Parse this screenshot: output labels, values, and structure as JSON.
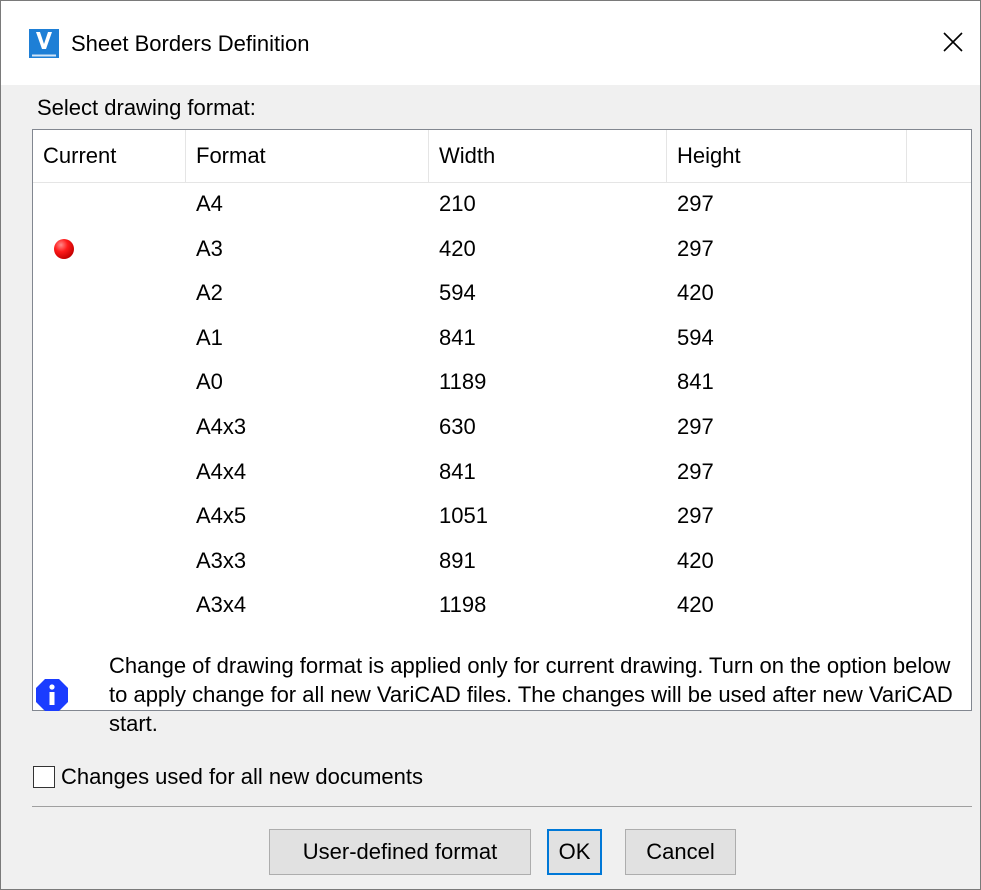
{
  "window": {
    "title": "Sheet Borders Definition",
    "icon": "varicad-logo-icon",
    "close_icon": "close-icon"
  },
  "select_label": "Select drawing format:",
  "table": {
    "columns": [
      "Current",
      "Format",
      "Width",
      "Height"
    ],
    "rows": [
      {
        "current": false,
        "format": "A4",
        "width": "210",
        "height": "297"
      },
      {
        "current": true,
        "format": "A3",
        "width": "420",
        "height": "297"
      },
      {
        "current": false,
        "format": "A2",
        "width": "594",
        "height": "420"
      },
      {
        "current": false,
        "format": "A1",
        "width": "841",
        "height": "594"
      },
      {
        "current": false,
        "format": "A0",
        "width": "1189",
        "height": "841"
      },
      {
        "current": false,
        "format": "A4x3",
        "width": "630",
        "height": "297"
      },
      {
        "current": false,
        "format": "A4x4",
        "width": "841",
        "height": "297"
      },
      {
        "current": false,
        "format": "A4x5",
        "width": "1051",
        "height": "297"
      },
      {
        "current": false,
        "format": "A3x3",
        "width": "891",
        "height": "420"
      },
      {
        "current": false,
        "format": "A3x4",
        "width": "1198",
        "height": "420"
      }
    ],
    "current_indicator_color": "#e60000"
  },
  "info": {
    "icon": "info-icon",
    "text": "Change of drawing format is applied only for current drawing. Turn on the option below to apply change for all new VariCAD files. The changes will be used after new VariCAD start.",
    "icon_color": "#1a3cff"
  },
  "checkbox": {
    "label": "Changes used for all new documents",
    "checked": false
  },
  "buttons": {
    "user_defined": "User-defined format",
    "ok": "OK",
    "cancel": "Cancel"
  },
  "colors": {
    "accent": "#0078d7",
    "dialog_bg": "#f0f0f0"
  }
}
